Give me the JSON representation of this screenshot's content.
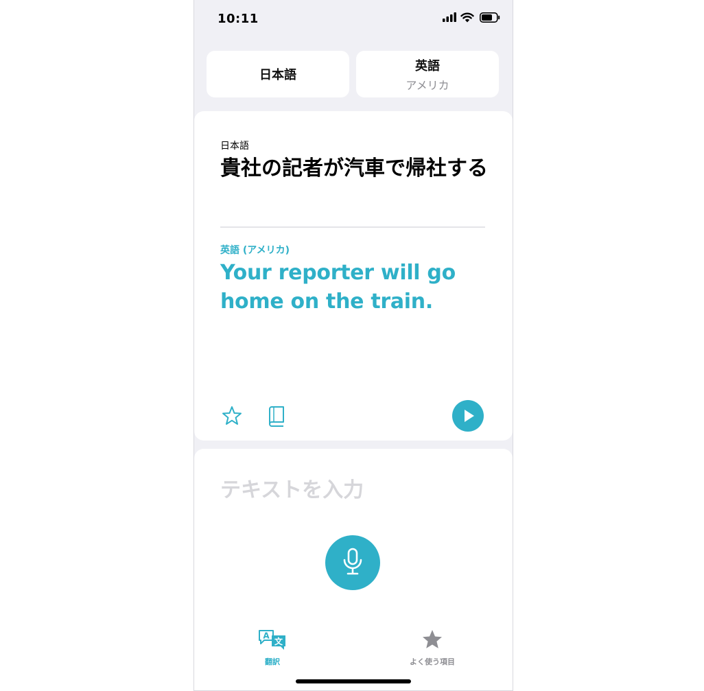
{
  "status_bar": {
    "time": "10:11",
    "icons": [
      "cellular-signal-icon",
      "wifi-icon",
      "battery-icon"
    ]
  },
  "language_selector": {
    "source": {
      "name": "日本語"
    },
    "target": {
      "name": "英語",
      "region": "アメリカ"
    }
  },
  "translation_card": {
    "source_label": "日本語",
    "source_text": "貴社の記者が汽車で帰社する",
    "target_label": "英語 (アメリカ)",
    "target_text": "Your reporter will go home on the train.",
    "actions": [
      "star-icon",
      "dictionary-book-icon",
      "play-icon"
    ]
  },
  "input_area": {
    "placeholder": "テキストを入力",
    "mic_icon": "microphone-icon"
  },
  "tab_bar": {
    "tabs": [
      {
        "label": "翻訳",
        "icon": "translate-icon",
        "selected": true
      },
      {
        "label": "よく使う項目",
        "icon": "star-filled-icon",
        "selected": false
      }
    ]
  },
  "colors": {
    "accent": "#2fb0c8",
    "background": "#f0f0f5",
    "card": "#ffffff",
    "secondary_text": "#8e8e93",
    "placeholder": "#d6d6da"
  }
}
